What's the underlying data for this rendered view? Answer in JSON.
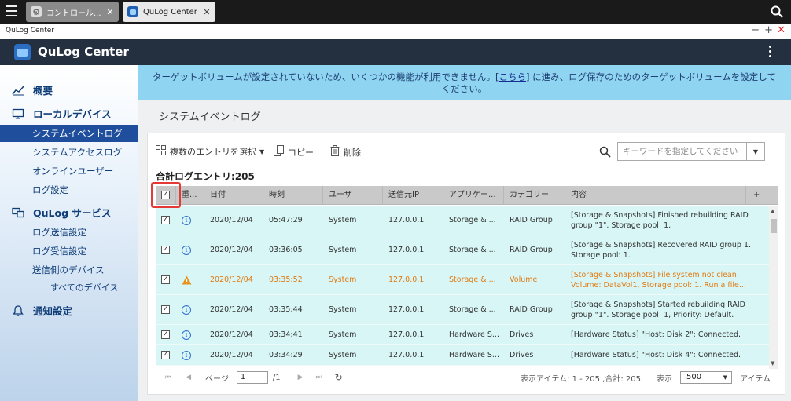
{
  "os": {
    "tabs": [
      {
        "label": "コントロール...",
        "icon": "gear-icon"
      },
      {
        "label": "QuLog Center",
        "icon": "qulog-icon"
      }
    ],
    "tab_close": "✕"
  },
  "window": {
    "title": "QuLog Center",
    "min": "−",
    "max": "+",
    "close": "✕"
  },
  "app": {
    "title": "QuLog Center"
  },
  "sidebar": {
    "overview": "概要",
    "local_devices": "ローカルデバイス",
    "system_event_log": "システムイベントログ",
    "system_access_log": "システムアクセスログ",
    "online_users": "オンラインユーザー",
    "log_settings": "ログ設定",
    "qulog_service": "QuLog サービス",
    "log_sender": "ログ送信設定",
    "log_receiver": "ログ受信設定",
    "sender_devices": "送信側のデバイス",
    "all_devices": "すべてのデバイス",
    "notification": "通知設定"
  },
  "banner": {
    "before": "ターゲットボリュームが設定されていないため、いくつかの機能が利用できません。[",
    "link": "こちら",
    "after": "] に進み、ログ保存のためのターゲットボリュームを設定してください。"
  },
  "page_title": "システムイベントログ",
  "toolbar": {
    "select_multi": "複数のエントリを選択",
    "copy": "コピー",
    "delete": "削除",
    "search_placeholder": "キーワードを指定してください"
  },
  "total_label": "合計ログエントリ:205",
  "columns": [
    "重...",
    "日付",
    "時刻",
    "ユーザ",
    "送信元IP",
    "アプリケー...",
    "カテゴリー",
    "内容",
    "+"
  ],
  "header_checkbox": "✓",
  "rows": [
    {
      "check": "✓",
      "severity": "info",
      "date": "2020/12/04",
      "time": "05:47:29",
      "user": "System",
      "ip": "127.0.0.1",
      "app": "Storage & ...",
      "category": "RAID Group",
      "content": "[Storage & Snapshots] Finished rebuilding RAID group \"1\". Storage pool: 1."
    },
    {
      "check": "✓",
      "severity": "info",
      "date": "2020/12/04",
      "time": "03:36:05",
      "user": "System",
      "ip": "127.0.0.1",
      "app": "Storage & ...",
      "category": "RAID Group",
      "content": "[Storage & Snapshots] Recovered RAID group 1. Storage pool: 1."
    },
    {
      "check": "✓",
      "severity": "warning",
      "date": "2020/12/04",
      "time": "03:35:52",
      "user": "System",
      "ip": "127.0.0.1",
      "app": "Storage & ...",
      "category": "Volume",
      "content": "[Storage & Snapshots] File system not clean. Volume: DataVol1, Storage pool: 1. Run a file..."
    },
    {
      "check": "✓",
      "severity": "info",
      "date": "2020/12/04",
      "time": "03:35:44",
      "user": "System",
      "ip": "127.0.0.1",
      "app": "Storage & ...",
      "category": "RAID Group",
      "content": "[Storage & Snapshots] Started rebuilding RAID group \"1\". Storage pool: 1, Priority: Default."
    },
    {
      "check": "✓",
      "severity": "info",
      "date": "2020/12/04",
      "time": "03:34:41",
      "user": "System",
      "ip": "127.0.0.1",
      "app": "Hardware S...",
      "category": "Drives",
      "content": "[Hardware Status] \"Host: Disk 2\": Connected."
    },
    {
      "check": "✓",
      "severity": "info",
      "date": "2020/12/04",
      "time": "03:34:29",
      "user": "System",
      "ip": "127.0.0.1",
      "app": "Hardware S...",
      "category": "Drives",
      "content": "[Hardware Status] \"Host: Disk 4\": Connected."
    }
  ],
  "pager": {
    "page_label": "ページ",
    "page_value": "1",
    "page_total": "/1",
    "display_items": "表示アイテム: 1 - 205 ,合計: 205",
    "display_label": "表示",
    "per_page": "500",
    "items_label": "アイテム"
  },
  "colors": {
    "accent": "#1f4f9c",
    "banner": "#8fd4f0",
    "row": "#d8f6f6",
    "warning": "#e07a10",
    "highlight": "#e53935"
  }
}
